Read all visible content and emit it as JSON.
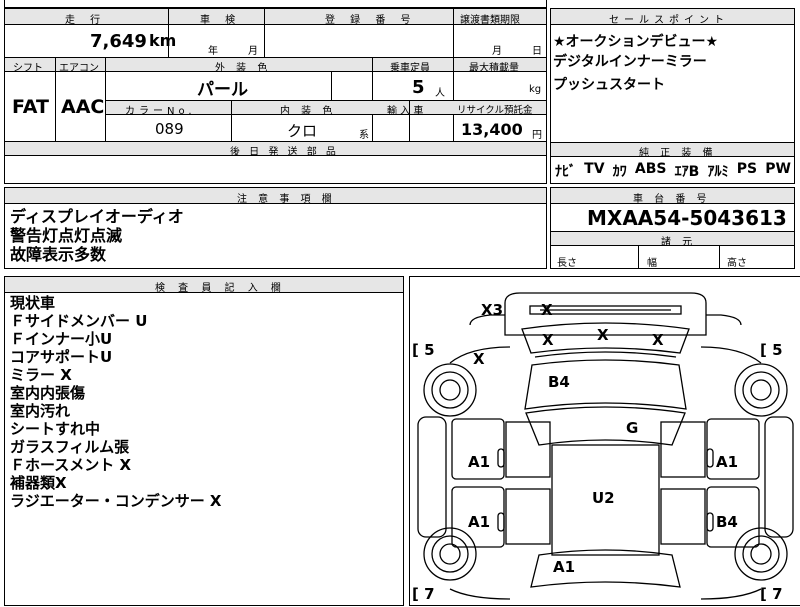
{
  "header": {
    "mileage_label": "走 行",
    "mileage_value": "7,649",
    "mileage_unit": "km",
    "shaken_label": "車 検",
    "shaken_year_unit": "年",
    "shaken_month_unit": "月",
    "registration_label": "登 録 番 号",
    "transfer_label": "譲渡書類期限",
    "transfer_month_unit": "月",
    "transfer_day_unit": "日"
  },
  "specs": {
    "shift_label": "シフト",
    "shift_value": "FAT",
    "aircon_label": "エアコン",
    "aircon_value": "AAC",
    "exterior_color_label": "外 装 色",
    "exterior_color_value": "パール",
    "capacity_label": "乗車定員",
    "capacity_value": "5",
    "capacity_unit": "人",
    "max_load_label": "最大積載量",
    "max_load_unit": "kg",
    "color_no_label": "カラーNo.",
    "color_no_value": "089",
    "interior_color_label": "内 装 色",
    "interior_color_value": "クロ",
    "interior_color_suffix": "系",
    "import_label": "輸 入 車",
    "recycle_label": "リサイクル預託金",
    "recycle_value": "13,400",
    "recycle_unit": "円",
    "later_parts_label": "後 日 発 送 部 品"
  },
  "sales_points": {
    "label": "セールスポイント",
    "lines": [
      "★オークションデビュー★",
      "デジタルインナーミラー",
      "プッシュスタート"
    ]
  },
  "equipment": {
    "label": "純 正 装 備",
    "items": [
      "ﾅﾋﾞ",
      "TV",
      "ｶﾜ",
      "ABS",
      "ｴｱB",
      "ｱﾙﾐ",
      "PS",
      "PW"
    ]
  },
  "caution": {
    "label": "注 意 事 項 欄",
    "lines": [
      "ディスプレイオーディオ",
      "警告灯点灯点滅",
      "故障表示多数"
    ]
  },
  "chassis": {
    "label": "車 台 番 号",
    "value": "MXAA54-5043613",
    "dimensions_label": "諸 元",
    "length_label": "長さ",
    "width_label": "幅",
    "height_label": "高さ"
  },
  "inspector": {
    "label": "検 査 員 記 入 欄",
    "lines": [
      "現状車",
      "Ｆサイドメンバー U",
      "Ｆインナー小U",
      "コアサポートU",
      "ミラー X",
      "室内内張傷",
      "室内汚れ",
      "シートすれ中",
      "ガラスフィルム張",
      "Ｆホースメント X",
      "補器類X",
      "ラジエーター・コンデンサー X"
    ]
  },
  "diagram": {
    "marks": {
      "x3": "X3",
      "roof_x": "X",
      "glass_x1": "X",
      "glass_x2": "X",
      "glass_x3": "X",
      "fender_x": "X",
      "b4_hood": "B4",
      "g": "G",
      "a1_left_front": "A1",
      "a1_right_front": "A1",
      "u2": "U2",
      "a1_left_rear": "A1",
      "b4_right_rear": "B4",
      "a1_rear": "A1"
    },
    "tires": {
      "fl": "[ 5",
      "fr": "[ 5",
      "rl": "[ 7",
      "rr": "[ 7"
    }
  }
}
